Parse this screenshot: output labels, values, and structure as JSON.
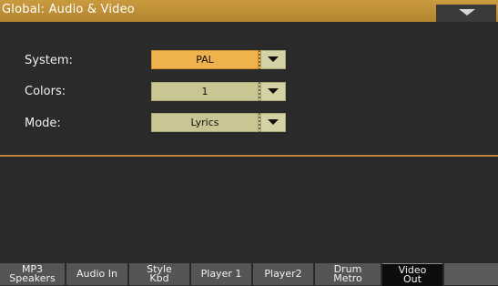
{
  "header": {
    "title": "Global: Audio & Video",
    "menu_icon": "triangle-down-icon"
  },
  "settings": [
    {
      "label": "System:",
      "value": "PAL",
      "active": true
    },
    {
      "label": "Colors:",
      "value": "1",
      "active": false
    },
    {
      "label": "Mode:",
      "value": "Lyrics",
      "active": false
    }
  ],
  "tabs": [
    {
      "line1": "MP3",
      "line2": "Speakers"
    },
    {
      "line1": "Audio In",
      "line2": ""
    },
    {
      "line1": "Style",
      "line2": "Kbd"
    },
    {
      "line1": "Player 1",
      "line2": ""
    },
    {
      "line1": "Player2",
      "line2": ""
    },
    {
      "line1": "Drum",
      "line2": "Metro"
    },
    {
      "line1": "Video",
      "line2": "Out",
      "selected": true
    }
  ],
  "colors": {
    "title_bar": "#b98a33",
    "combo_active": "#f0b24c",
    "combo_normal": "#cac694",
    "separator": "#c0823a",
    "tab_normal": "#555555",
    "tab_selected": "#0d0d0d"
  }
}
